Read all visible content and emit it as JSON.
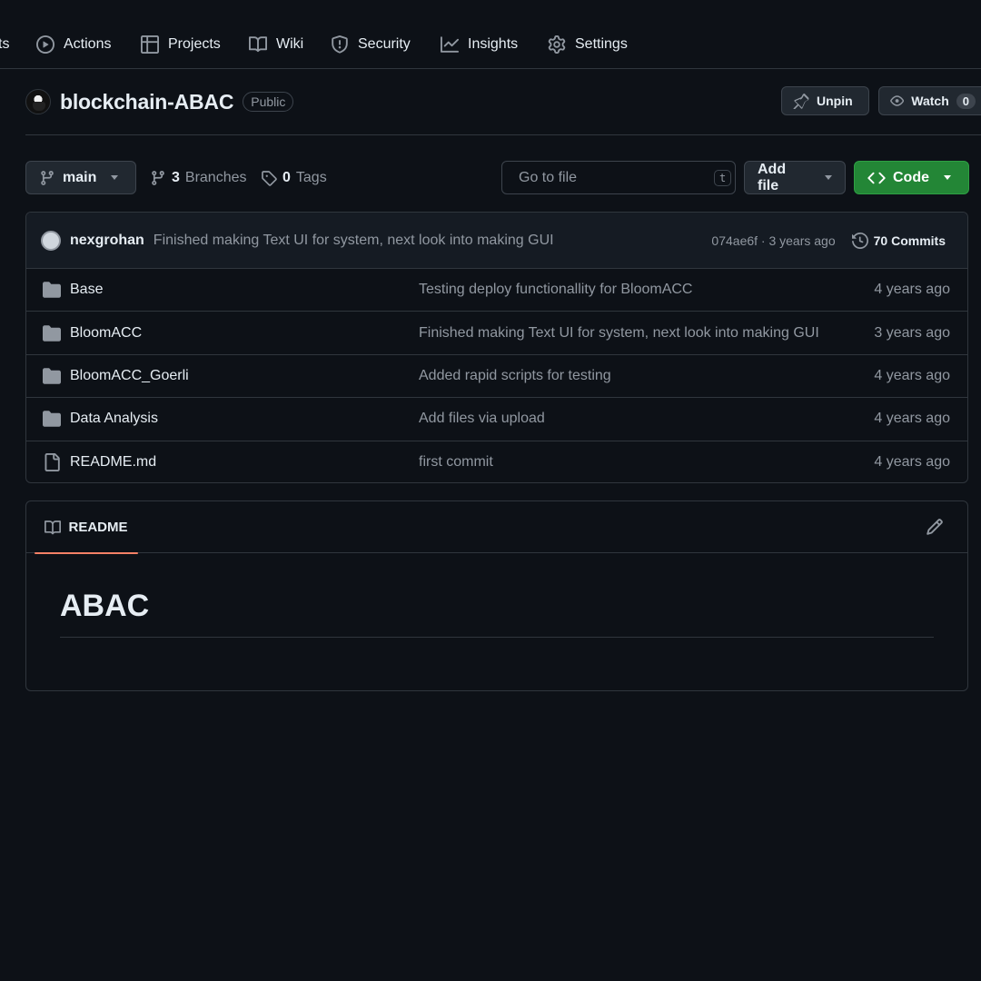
{
  "nav": {
    "cut_label": "ts",
    "items": [
      {
        "label": "Actions",
        "icon": "play-circle-icon"
      },
      {
        "label": "Projects",
        "icon": "table-icon"
      },
      {
        "label": "Wiki",
        "icon": "book-icon"
      },
      {
        "label": "Security",
        "icon": "shield-icon"
      },
      {
        "label": "Insights",
        "icon": "graph-icon"
      },
      {
        "label": "Settings",
        "icon": "gear-icon"
      }
    ]
  },
  "repo": {
    "name": "blockchain-ABAC",
    "visibility": "Public",
    "unpin_label": "Unpin",
    "watch_label": "Watch",
    "watch_count": "0"
  },
  "toolbar": {
    "branch": "main",
    "branches_count": "3",
    "branches_label": "Branches",
    "tags_count": "0",
    "tags_label": "Tags",
    "search_placeholder": "Go to file",
    "search_shortcut": "t",
    "add_file_label": "Add file",
    "code_label": "Code"
  },
  "latest_commit": {
    "author": "nexgrohan",
    "message": "Finished making Text UI for system, next look into making GUI",
    "hash_time": "074ae6f · 3 years ago",
    "commits_label": "70 Commits"
  },
  "files": [
    {
      "name": "Base",
      "type": "folder",
      "message": "Testing deploy functionallity for BloomACC",
      "date": "4 years ago"
    },
    {
      "name": "BloomACC",
      "type": "folder",
      "message": "Finished making Text UI for system, next look into making GUI",
      "date": "3 years ago"
    },
    {
      "name": "BloomACC_Goerli",
      "type": "folder",
      "message": "Added rapid scripts for testing",
      "date": "4 years ago"
    },
    {
      "name": "Data Analysis",
      "type": "folder",
      "message": "Add files via upload",
      "date": "4 years ago"
    },
    {
      "name": "README.md",
      "type": "file",
      "message": "first commit",
      "date": "4 years ago"
    }
  ],
  "readme": {
    "tab_label": "README",
    "heading": "ABAC"
  },
  "colors": {
    "background": "#0d1117",
    "accent_green": "#238636",
    "tab_underline": "#f78166"
  }
}
